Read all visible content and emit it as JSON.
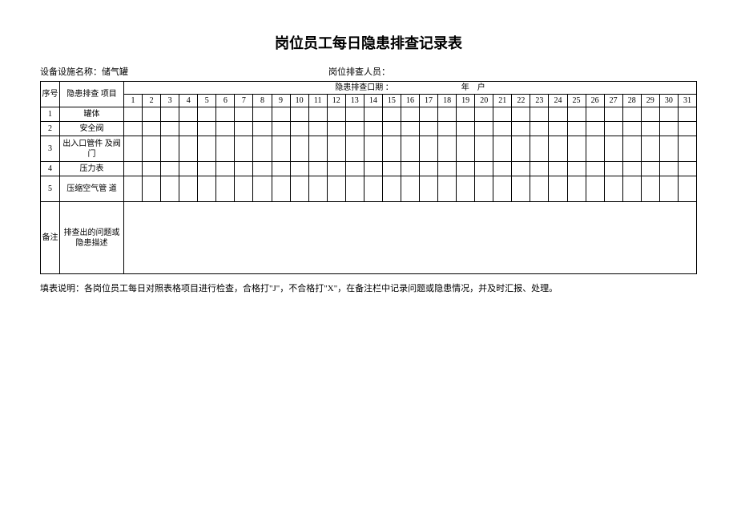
{
  "title": "岗位员工每日隐患排查记录表",
  "info": {
    "equip_label": "设备设施名称：储气罐",
    "inspector_label": "岗位排查人员："
  },
  "header": {
    "seq": "序号",
    "item": "隐患排查 项目",
    "date_label": "隐患排查口期 ：",
    "year": "年",
    "month": "户"
  },
  "days": [
    "1",
    "2",
    "3",
    "4",
    "5",
    "6",
    "7",
    "8",
    "9",
    "10",
    "11",
    "12",
    "13",
    "14",
    "15",
    "16",
    "17",
    "18",
    "19",
    "20",
    "21",
    "22",
    "23",
    "24",
    "25",
    "26",
    "27",
    "28",
    "29",
    "30",
    "31"
  ],
  "rows": [
    {
      "seq": "1",
      "item": "罐体"
    },
    {
      "seq": "2",
      "item": "安全阀"
    },
    {
      "seq": "3",
      "item": "出入口管件 及阀门"
    },
    {
      "seq": "4",
      "item": "压力表"
    },
    {
      "seq": "5",
      "item": "压缩空气管 道"
    }
  ],
  "remark": {
    "seq_label": "备注",
    "item_label": "排查出的问题或隐患描述"
  },
  "notes": "填表说明：各岗位员工每日对照表格项目进行检查，合格打\"J\"，不合格打\"X\"，在备注栏中记录问题或隐患情况，并及时汇报、处理。"
}
